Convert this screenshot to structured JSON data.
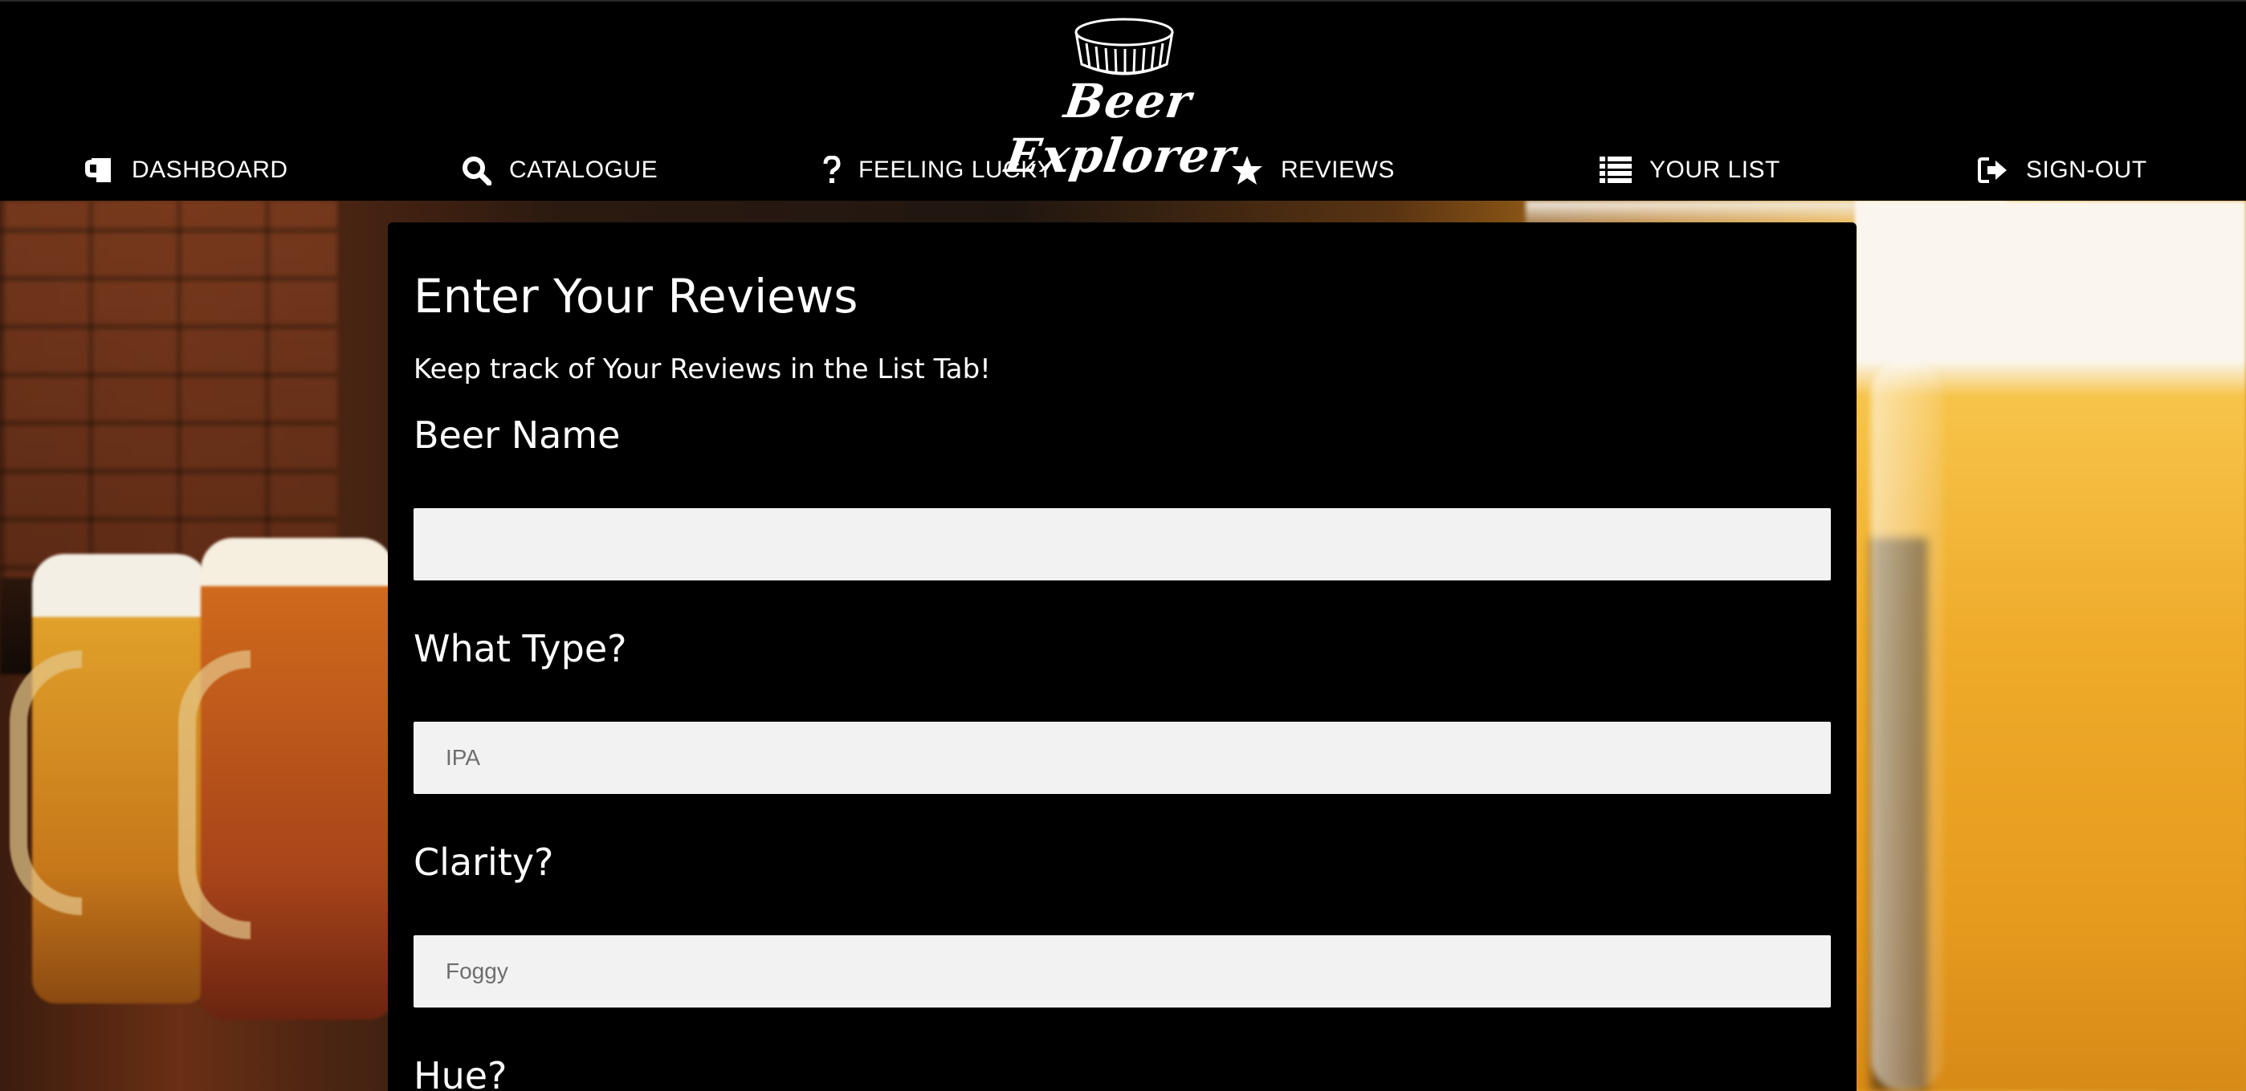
{
  "app": {
    "logo_text": "Beer Explorer",
    "logo_icon": "bottle-cap-icon"
  },
  "nav": {
    "items": [
      {
        "label": "DASHBOARD",
        "icon": "mug-icon"
      },
      {
        "label": "CATALOGUE",
        "icon": "search-icon"
      },
      {
        "label": "FEELING LUCKY",
        "icon": "question-icon"
      },
      {
        "label": "REVIEWS",
        "icon": "star-icon"
      },
      {
        "label": "YOUR LIST",
        "icon": "list-icon"
      },
      {
        "label": "SIGN-OUT",
        "icon": "sign-out-icon"
      }
    ]
  },
  "form": {
    "title": "Enter Your Reviews",
    "subtitle": "Keep track of Your Reviews in the List Tab!",
    "fields": [
      {
        "label": "Beer Name",
        "placeholder": "",
        "value": ""
      },
      {
        "label": "What Type?",
        "placeholder": "IPA",
        "value": ""
      },
      {
        "label": "Clarity?",
        "placeholder": "Foggy",
        "value": ""
      },
      {
        "label": "Hue?",
        "placeholder": "",
        "value": ""
      }
    ]
  },
  "colors": {
    "header_bg": "#000000",
    "card_bg": "#000000",
    "input_bg": "#f2f2f2",
    "text": "#ffffff"
  }
}
